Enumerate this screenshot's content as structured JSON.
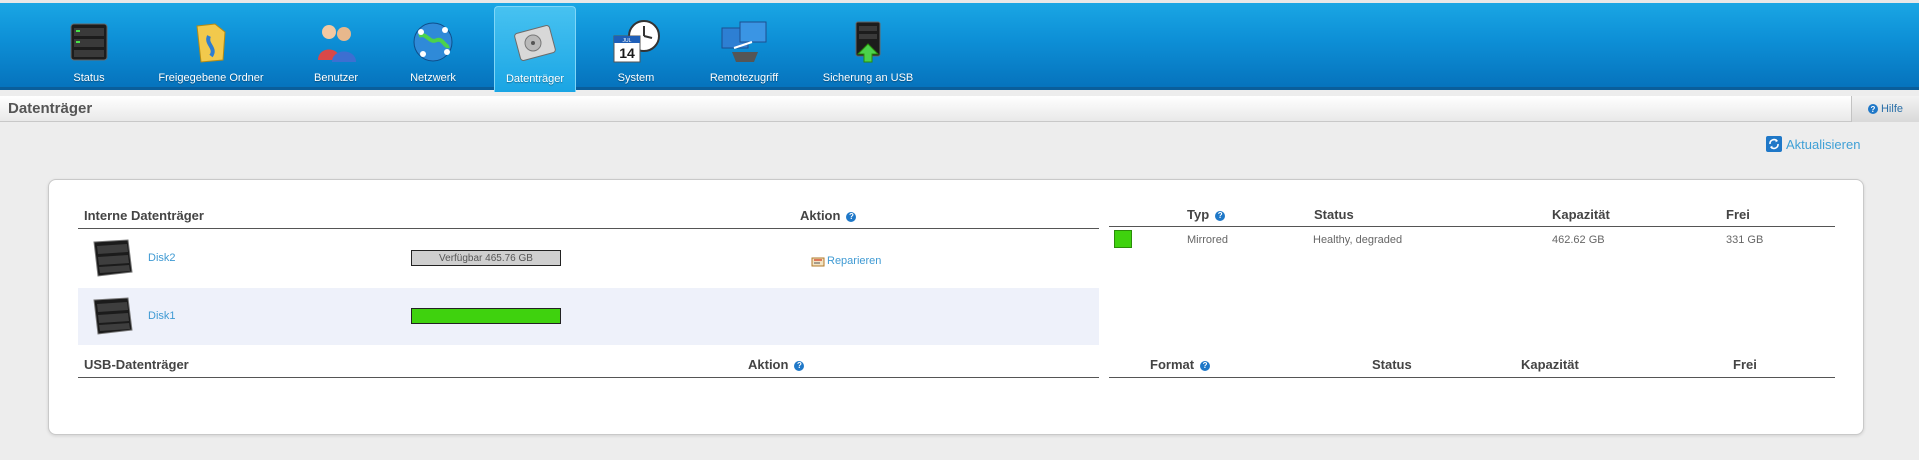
{
  "nav": {
    "items": [
      {
        "label": "Status",
        "icon": "status-server-icon"
      },
      {
        "label": "Freigegebene Ordner",
        "icon": "shared-folder-icon"
      },
      {
        "label": "Benutzer",
        "icon": "users-icon"
      },
      {
        "label": "Netzwerk",
        "icon": "network-globe-icon"
      },
      {
        "label": "Datenträger",
        "icon": "hard-disk-icon"
      },
      {
        "label": "System",
        "icon": "calendar-clock-icon"
      },
      {
        "label": "Remotezugriff",
        "icon": "remote-access-icon"
      },
      {
        "label": "Sicherung an USB",
        "icon": "usb-backup-icon"
      }
    ],
    "active": "Datenträger",
    "calendar_month": "JUL",
    "calendar_day": "14"
  },
  "page": {
    "title": "Datenträger",
    "help_label": "Hilfe",
    "refresh_label": "Aktualisieren"
  },
  "internal": {
    "headers": {
      "name": "Interne Datenträger",
      "action": "Aktion",
      "type": "Typ",
      "status": "Status",
      "capacity": "Kapazität",
      "free": "Frei"
    },
    "disks": [
      {
        "name": "Disk2",
        "bar_label": "Verfügbar 465.76 GB",
        "action": "Reparieren"
      },
      {
        "name": "Disk1",
        "bar_label": ""
      }
    ],
    "volume": {
      "type": "Mirrored",
      "status": "Healthy, degraded",
      "capacity": "462.62 GB",
      "free": "331 GB"
    }
  },
  "usb": {
    "headers": {
      "name": "USB-Datenträger",
      "action": "Aktion",
      "format": "Format",
      "status": "Status",
      "capacity": "Kapazität",
      "free": "Frei"
    }
  },
  "colors": {
    "nav_blue": "#0d8fd6",
    "link": "#3f9ad3",
    "healthy_green": "#3fd20e",
    "unavailable_gray": "#cfcfcf"
  }
}
